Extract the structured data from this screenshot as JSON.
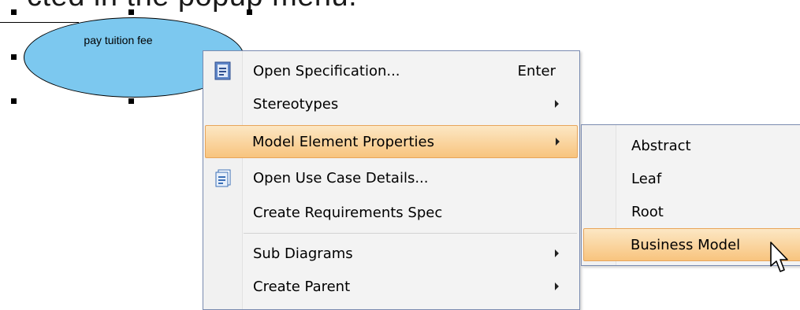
{
  "page": {
    "top_text": "cted in the popup menu."
  },
  "diagram": {
    "use_case_label": "pay tuition fee",
    "ellipse_fill": "#7cc8ef"
  },
  "context_menu": {
    "items": [
      {
        "label": "Open Specification...",
        "shortcut": "Enter",
        "icon": "specification-icon"
      },
      {
        "label": "Stereotypes",
        "submenu": true
      },
      {
        "label": "Model Element Properties",
        "submenu": true,
        "highlighted": true
      },
      {
        "label": "Open Use Case Details...",
        "icon": "use-case-details-icon"
      },
      {
        "label": "Create Requirements Spec"
      },
      {
        "label": "Sub Diagrams",
        "submenu": true
      },
      {
        "label": "Create Parent",
        "submenu": true
      }
    ]
  },
  "submenu": {
    "items": [
      {
        "label": "Abstract"
      },
      {
        "label": "Leaf"
      },
      {
        "label": "Root"
      },
      {
        "label": "Business Model",
        "highlighted": true
      }
    ]
  },
  "colors": {
    "highlight_top": "#fce7c4",
    "highlight_bottom": "#f8c47e",
    "menu_border": "#7a8bb0"
  }
}
